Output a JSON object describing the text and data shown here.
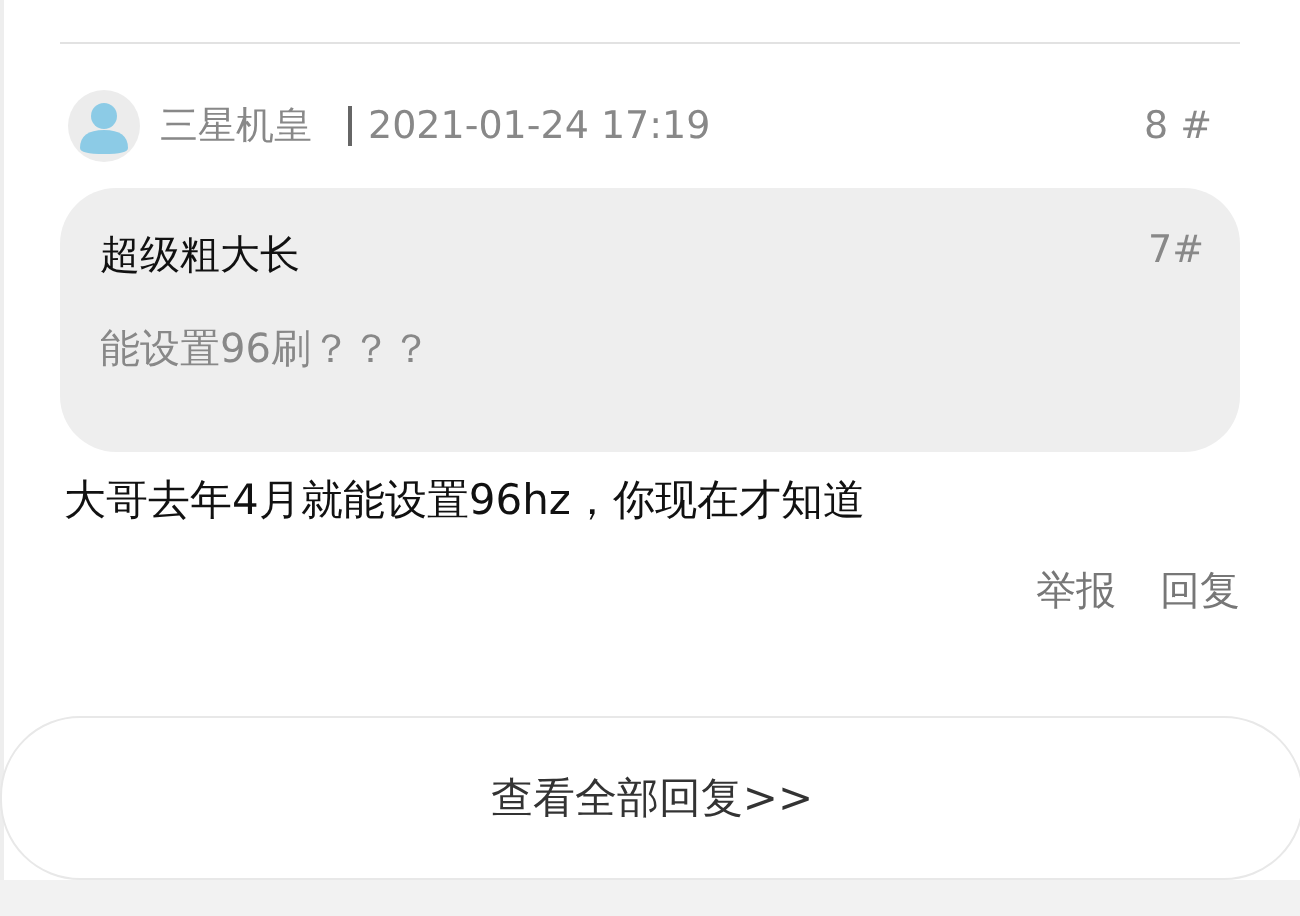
{
  "post": {
    "author": "三星机皇",
    "time": "2021-01-24 17:19",
    "floor": "8 #",
    "quote": {
      "author": "超级粗大长",
      "floor": "7#",
      "text": "能设置96刷？？？"
    },
    "content": "大哥去年4月就能设置96hz，你现在才知道",
    "actions": [
      {
        "label": "举报"
      },
      {
        "label": "回复"
      }
    ]
  },
  "view_all": "查看全部回复>>"
}
